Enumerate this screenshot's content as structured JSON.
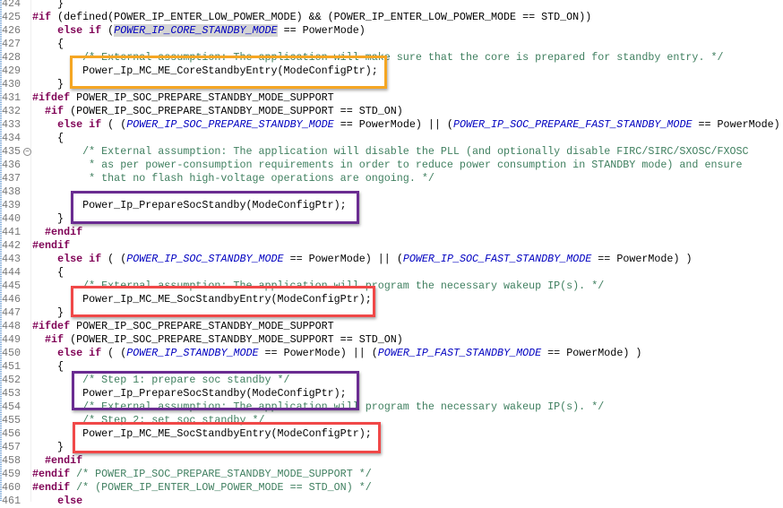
{
  "colors": {
    "orange": "#f5a623",
    "purple": "#6a2c91",
    "red": "#f04848"
  },
  "lines": [
    {
      "n": "424",
      "s": [
        [
          "p",
          "    }"
        ]
      ]
    },
    {
      "n": "425",
      "s": [
        [
          "k",
          "#if"
        ],
        [
          "p",
          " (defined(POWER_IP_ENTER_LOW_POWER_MODE) && (POWER_IP_ENTER_LOW_POWER_MODE == STD_ON))"
        ]
      ]
    },
    {
      "n": "426",
      "s": [
        [
          "p",
          "    "
        ],
        [
          "k",
          "else if"
        ],
        [
          "p",
          " ("
        ],
        [
          "mh",
          "POWER_IP_CORE_STANDBY_MODE"
        ],
        [
          "p",
          " == PowerMode)"
        ]
      ]
    },
    {
      "n": "427",
      "s": [
        [
          "p",
          "    {"
        ]
      ]
    },
    {
      "n": "428",
      "s": [
        [
          "p",
          "        "
        ],
        [
          "c",
          "/* External assumption: The application will make sure that the core is prepared for standby entry. */"
        ]
      ]
    },
    {
      "n": "429",
      "s": [
        [
          "p",
          "        Power_Ip_MC_ME_CoreStandbyEntry(ModeConfigPtr);"
        ]
      ]
    },
    {
      "n": "430",
      "s": [
        [
          "p",
          "    }"
        ]
      ]
    },
    {
      "n": "431",
      "s": [
        [
          "k",
          "#ifdef"
        ],
        [
          "p",
          " POWER_IP_SOC_PREPARE_STANDBY_MODE_SUPPORT"
        ]
      ]
    },
    {
      "n": "432",
      "s": [
        [
          "p",
          "  "
        ],
        [
          "k",
          "#if"
        ],
        [
          "p",
          " (POWER_IP_SOC_PREPARE_STANDBY_MODE_SUPPORT == STD_ON)"
        ]
      ]
    },
    {
      "n": "433",
      "s": [
        [
          "p",
          "    "
        ],
        [
          "k",
          "else if"
        ],
        [
          "p",
          " ( ("
        ],
        [
          "m",
          "POWER_IP_SOC_PREPARE_STANDBY_MODE"
        ],
        [
          "p",
          " == PowerMode) || ("
        ],
        [
          "m",
          "POWER_IP_SOC_PREPARE_FAST_STANDBY_MODE"
        ],
        [
          "p",
          " == PowerMode)"
        ]
      ]
    },
    {
      "n": "434",
      "s": [
        [
          "p",
          "    {"
        ]
      ]
    },
    {
      "n": "435",
      "fold": true,
      "s": [
        [
          "p",
          "        "
        ],
        [
          "c",
          "/* External assumption: The application will disable the PLL (and optionally disable FIRC/SIRC/SXOSC/FXOSC"
        ]
      ]
    },
    {
      "n": "436",
      "s": [
        [
          "p",
          "         "
        ],
        [
          "c",
          "* as per power-consumption requirements in order to reduce power consumption in STANDBY mode) and ensure"
        ]
      ]
    },
    {
      "n": "437",
      "s": [
        [
          "p",
          "         "
        ],
        [
          "c",
          "* that no flash high-voltage operations are ongoing. */"
        ]
      ]
    },
    {
      "n": "438",
      "s": []
    },
    {
      "n": "439",
      "s": [
        [
          "p",
          "        Power_Ip_PrepareSocStandby(ModeConfigPtr);"
        ]
      ]
    },
    {
      "n": "440",
      "s": [
        [
          "p",
          "    }"
        ]
      ]
    },
    {
      "n": "441",
      "s": [
        [
          "p",
          "  "
        ],
        [
          "k",
          "#endif"
        ]
      ]
    },
    {
      "n": "442",
      "s": [
        [
          "k",
          "#endif"
        ]
      ]
    },
    {
      "n": "443",
      "s": [
        [
          "p",
          "    "
        ],
        [
          "k",
          "else if"
        ],
        [
          "p",
          " ( ("
        ],
        [
          "m",
          "POWER_IP_SOC_STANDBY_MODE"
        ],
        [
          "p",
          " == PowerMode) || ("
        ],
        [
          "m",
          "POWER_IP_SOC_FAST_STANDBY_MODE"
        ],
        [
          "p",
          " == PowerMode) )"
        ]
      ]
    },
    {
      "n": "444",
      "s": [
        [
          "p",
          "    {"
        ]
      ]
    },
    {
      "n": "445",
      "s": [
        [
          "p",
          "        "
        ],
        [
          "c",
          "/* External assumption: The application will program the necessary wakeup IP(s). */"
        ]
      ]
    },
    {
      "n": "446",
      "s": [
        [
          "p",
          "        Power_Ip_MC_ME_SocStandbyEntry(ModeConfigPtr);"
        ]
      ]
    },
    {
      "n": "447",
      "s": [
        [
          "p",
          "    }"
        ]
      ]
    },
    {
      "n": "448",
      "s": [
        [
          "k",
          "#ifdef"
        ],
        [
          "p",
          " POWER_IP_SOC_PREPARE_STANDBY_MODE_SUPPORT"
        ]
      ]
    },
    {
      "n": "449",
      "s": [
        [
          "p",
          "  "
        ],
        [
          "k",
          "#if"
        ],
        [
          "p",
          " (POWER_IP_SOC_PREPARE_STANDBY_MODE_SUPPORT == STD_ON)"
        ]
      ]
    },
    {
      "n": "450",
      "s": [
        [
          "p",
          "    "
        ],
        [
          "k",
          "else if"
        ],
        [
          "p",
          " ( ("
        ],
        [
          "m",
          "POWER_IP_STANDBY_MODE"
        ],
        [
          "p",
          " == PowerMode) || ("
        ],
        [
          "m",
          "POWER_IP_FAST_STANDBY_MODE"
        ],
        [
          "p",
          " == PowerMode) )"
        ]
      ]
    },
    {
      "n": "451",
      "s": [
        [
          "p",
          "    {"
        ]
      ]
    },
    {
      "n": "452",
      "s": [
        [
          "p",
          "        "
        ],
        [
          "c",
          "/* Step 1: prepare soc standby */"
        ]
      ]
    },
    {
      "n": "453",
      "s": [
        [
          "p",
          "        Power_Ip_PrepareSocStandby(ModeConfigPtr);"
        ]
      ]
    },
    {
      "n": "454",
      "s": [
        [
          "p",
          "        "
        ],
        [
          "c",
          "/* External assumption: The application will program the necessary wakeup IP(s). */"
        ]
      ]
    },
    {
      "n": "455",
      "s": [
        [
          "p",
          "        "
        ],
        [
          "c",
          "/* Step 2: set soc standby */"
        ]
      ]
    },
    {
      "n": "456",
      "s": [
        [
          "p",
          "        Power_Ip_MC_ME_SocStandbyEntry(ModeConfigPtr);"
        ]
      ]
    },
    {
      "n": "457",
      "s": [
        [
          "p",
          "    }"
        ]
      ]
    },
    {
      "n": "458",
      "s": [
        [
          "p",
          "  "
        ],
        [
          "k",
          "#endif"
        ]
      ]
    },
    {
      "n": "459",
      "s": [
        [
          "k",
          "#endif"
        ],
        [
          "p",
          " "
        ],
        [
          "c",
          "/* POWER_IP_SOC_PREPARE_STANDBY_MODE_SUPPORT */"
        ]
      ]
    },
    {
      "n": "460",
      "s": [
        [
          "k",
          "#endif"
        ],
        [
          "p",
          " "
        ],
        [
          "c",
          "/* (POWER_IP_ENTER_LOW_POWER_MODE == STD_ON) */"
        ]
      ]
    },
    {
      "n": "461",
      "s": [
        [
          "p",
          "    "
        ],
        [
          "k",
          "else"
        ]
      ]
    }
  ]
}
